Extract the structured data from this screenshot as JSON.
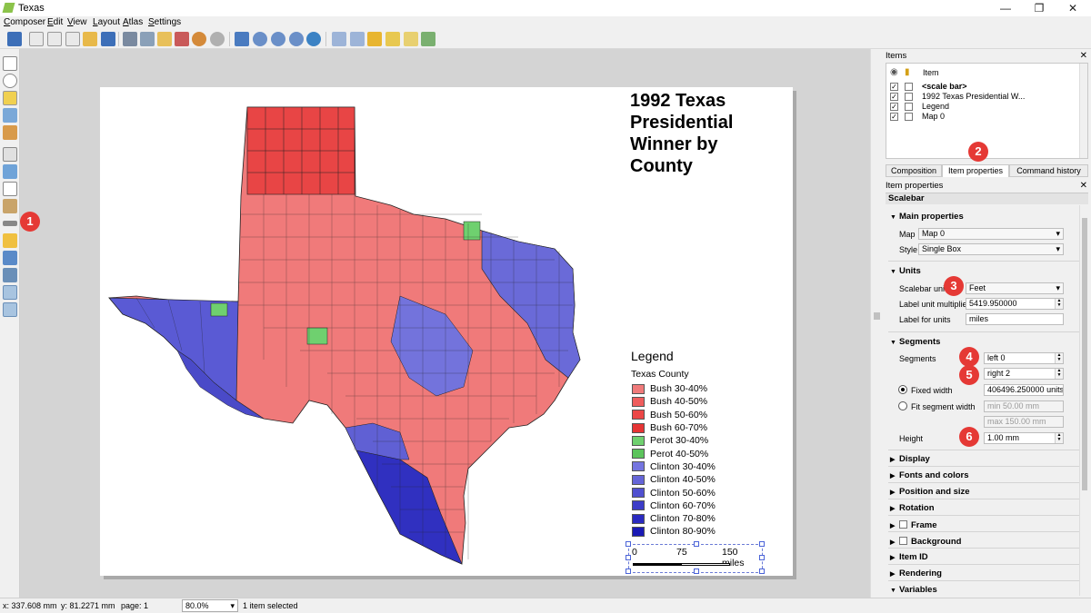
{
  "window": {
    "title": "Texas"
  },
  "menu": [
    "Composer",
    "Edit",
    "View",
    "Layout",
    "Atlas",
    "Settings"
  ],
  "toolbar_icons": [
    "save-icon",
    "new-composer-icon",
    "duplicate-composer-icon",
    "composer-manager-icon",
    "open-template-icon",
    "save-template-icon",
    "print-icon",
    "export-image-icon",
    "export-svg-icon",
    "export-pdf-icon",
    "undo-icon",
    "redo-icon",
    "zoom-full-icon",
    "zoom-100-icon",
    "zoom-in-icon",
    "zoom-out-icon",
    "refresh-icon",
    "group-icon",
    "ungroup-icon",
    "lock-icon",
    "raise-icon",
    "align-icon"
  ],
  "left_tools": [
    "pan-icon",
    "zoom-tool-icon",
    "select-icon",
    "move-content-icon",
    "edit-nodes-icon",
    "add-map-icon",
    "add-image-icon",
    "add-label-icon",
    "add-legend-icon",
    "add-scalebar-icon",
    "add-shape-icon",
    "add-node-icon",
    "add-arrow-icon",
    "add-table-icon",
    "add-html-icon"
  ],
  "map": {
    "title": "1992 Texas Presidential Winner by County",
    "legend": {
      "title": "Legend",
      "subtitle": "Texas County",
      "items": [
        {
          "label": "Bush 30-40%",
          "color": "#f07a7a"
        },
        {
          "label": "Bush 40-50%",
          "color": "#ef5d5d"
        },
        {
          "label": "Bush 50-60%",
          "color": "#ec4747"
        },
        {
          "label": "Bush 60-70%",
          "color": "#e63434"
        },
        {
          "label": "Perot 30-40%",
          "color": "#6fd06f"
        },
        {
          "label": "Perot 40-50%",
          "color": "#5cc45c"
        },
        {
          "label": "Clinton 30-40%",
          "color": "#7575e0"
        },
        {
          "label": "Clinton 40-50%",
          "color": "#6565d8"
        },
        {
          "label": "Clinton 50-60%",
          "color": "#5050d0"
        },
        {
          "label": "Clinton 60-70%",
          "color": "#3c3cc8"
        },
        {
          "label": "Clinton 70-80%",
          "color": "#2a2ac0"
        },
        {
          "label": "Clinton 80-90%",
          "color": "#1a1ab5"
        }
      ]
    },
    "scalebar": {
      "left": "0",
      "mid": "75",
      "right": "150 miles"
    }
  },
  "items_panel": {
    "header": "Items",
    "column": "Item",
    "rows": [
      {
        "label": "<scale bar>",
        "bold": true
      },
      {
        "label": "1992 Texas Presidential W...",
        "bold": false
      },
      {
        "label": "Legend",
        "bold": false
      },
      {
        "label": "Map 0",
        "bold": false
      }
    ]
  },
  "tabs": [
    "Composition",
    "Item properties",
    "Command history"
  ],
  "props": {
    "header": "Item properties",
    "item_type": "Scalebar",
    "main_section": "Main properties",
    "map_label": "Map",
    "map_value": "Map 0",
    "style_label": "Style",
    "style_value": "Single Box",
    "units_section": "Units",
    "scalebar_units_label": "Scalebar units",
    "scalebar_units_value": "Feet",
    "label_multiplier_label": "Label unit multiplier",
    "label_multiplier_value": "5419.950000",
    "label_units_label": "Label for units",
    "label_units_value": "miles",
    "segments_section": "Segments",
    "segments_label": "Segments",
    "segments_left": "left 0",
    "segments_right": "right 2",
    "fixed_width_label": "Fixed width",
    "fixed_width_value": "406496.250000 units",
    "fit_width_label": "Fit segment width",
    "min_value": "min 50.00 mm",
    "max_value": "max 150.00 mm",
    "height_label": "Height",
    "height_value": "1.00 mm",
    "collapsed_sections": [
      "Display",
      "Fonts and colors",
      "Position and size",
      "Rotation",
      "Frame",
      "Background",
      "Item ID",
      "Rendering",
      "Variables"
    ]
  },
  "badges": [
    "1",
    "2",
    "3",
    "4",
    "5",
    "6"
  ],
  "status": {
    "x": "x: 337.608 mm",
    "y": "y: 81.2271 mm",
    "page": "page: 1",
    "zoom": "80.0%",
    "selection": "1 item selected"
  }
}
